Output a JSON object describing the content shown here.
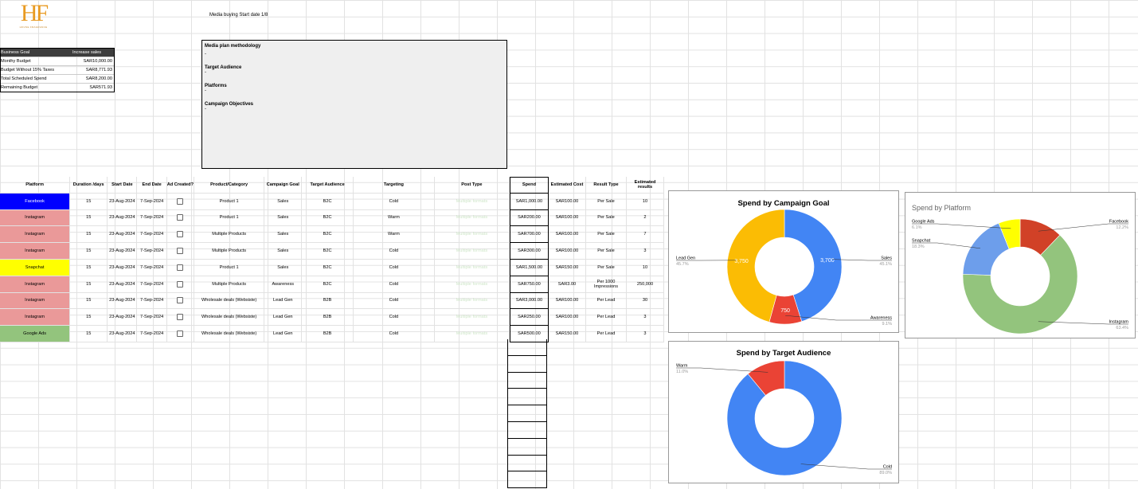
{
  "logo": {
    "mark": "HF",
    "sub": "HOUSE FRAGRANCE"
  },
  "header": {
    "start_date": "Media buying Start date 1/8"
  },
  "summary": [
    {
      "k": "Business Goal",
      "v": "Increase sales"
    },
    {
      "k": "Monthy Budget",
      "v": "SAR10,000.00"
    },
    {
      "k": "Budget Without 15% Taxes",
      "v": "SAR8,771.93"
    },
    {
      "k": "Total Scheduled Spend",
      "v": "SAR8,200.00"
    },
    {
      "k": "Remaining Budget",
      "v": "SAR571.93"
    }
  ],
  "methodology": {
    "title": "Media plan methodology",
    "sections": [
      {
        "h": "Target Audience",
        "d": "-"
      },
      {
        "h": "Platforms",
        "d": "-"
      },
      {
        "h": "Campaign Objectives",
        "d": "-"
      }
    ],
    "first_dash": "-"
  },
  "table": {
    "headers": [
      "Platform",
      "Duration /days",
      "Start Date",
      "End Date",
      "Ad Created?",
      "Product/Category",
      "Campaign Goal",
      "Target Audience",
      "Targeting",
      "Post Type",
      "Spend",
      "Estimated Cost",
      "Result Type",
      "Estimated results"
    ],
    "rows": [
      [
        "Facebook",
        "15",
        "23-Aug-2024",
        "7-Sep-2024",
        "",
        "Product 1",
        "Sales",
        "B2C",
        "Cold",
        "Multiple formats",
        "SAR1,000.00",
        "SAR100.00",
        "Per Sale",
        "10"
      ],
      [
        "Instagram",
        "15",
        "23-Aug-2024",
        "7-Sep-2024",
        "",
        "Product 1",
        "Sales",
        "B2C",
        "Warm",
        "Multiple formats",
        "SAR200.00",
        "SAR100.00",
        "Per Sale",
        "2"
      ],
      [
        "Instagram",
        "15",
        "23-Aug-2024",
        "7-Sep-2024",
        "",
        "Multiple Products",
        "Sales",
        "B2C",
        "Warm",
        "Multiple formats",
        "SAR700.00",
        "SAR100.00",
        "Per Sale",
        "7"
      ],
      [
        "Instagram",
        "15",
        "23-Aug-2024",
        "7-Sep-2024",
        "",
        "Multiple Products",
        "Sales",
        "B2C",
        "Cold",
        "Multiple formats",
        "SAR300.00",
        "SAR100.00",
        "Per Sale",
        "3"
      ],
      [
        "Snapchat",
        "15",
        "23-Aug-2024",
        "7-Sep-2024",
        "",
        "Product 1",
        "Sales",
        "B2C",
        "Cold",
        "Multiple formats",
        "SAR1,500.00",
        "SAR150.00",
        "Per Sale",
        "10"
      ],
      [
        "Instagram",
        "15",
        "23-Aug-2024",
        "7-Sep-2024",
        "",
        "Multiple Products",
        "Awareness",
        "B2C",
        "Cold",
        "Multiple formats",
        "SAR750.00",
        "SAR3.00",
        "Per 1000 Impressions",
        "250,000"
      ],
      [
        "Instagram",
        "15",
        "23-Aug-2024",
        "7-Sep-2024",
        "",
        "Wholesale deals (Websiste)",
        "Lead Gen",
        "B2B",
        "Cold",
        "Multiple formats",
        "SAR3,000.00",
        "SAR100.00",
        "Per Lead",
        "30"
      ],
      [
        "Instagram",
        "15",
        "23-Aug-2024",
        "7-Sep-2024",
        "",
        "Wholesale deals (Websiste)",
        "Lead Gen",
        "B2B",
        "Cold",
        "Multiple formats",
        "SAR250.00",
        "SAR100.00",
        "Per Lead",
        "3"
      ],
      [
        "Google Ads",
        "15",
        "23-Aug-2024",
        "7-Sep-2024",
        "",
        "Wholesale deals (Websiste)",
        "Lead Gen",
        "B2B",
        "Cold",
        "Multiple formats",
        "SAR500.00",
        "SAR150.00",
        "Per Lead",
        "3"
      ]
    ]
  },
  "colors": {
    "Facebook": "#0000ff",
    "Instagram": "#ea9999",
    "Snapchat": "#ffff00",
    "Google Ads": "#93c47d"
  },
  "charts": {
    "goal": {
      "title": "Spend by Campaign Goal",
      "slices": [
        {
          "name": "Sales",
          "value": 3700,
          "label": "3,700",
          "pct": "45.1%",
          "color": "#4285f4"
        },
        {
          "name": "Awareness",
          "value": 750,
          "label": "750",
          "pct": "9.1%",
          "color": "#ea4335"
        },
        {
          "name": "Lead Gen",
          "value": 3750,
          "label": "3,750",
          "pct": "45.7%",
          "color": "#fbbc04"
        }
      ]
    },
    "platform": {
      "title": "Spend by Platform",
      "slices": [
        {
          "name": "Facebook",
          "value": 1000,
          "pct": "12.2%",
          "color": "#d14127"
        },
        {
          "name": "Instagram",
          "value": 5200,
          "pct": "63.4%",
          "color": "#93c47d"
        },
        {
          "name": "Snapchat",
          "value": 1500,
          "pct": "18.3%",
          "color": "#6d9eeb"
        },
        {
          "name": "Google Ads",
          "value": 500,
          "pct": "6.1%",
          "color": "#ffff00"
        }
      ]
    },
    "audience": {
      "title": "Spend by Target Audience",
      "slices": [
        {
          "name": "Cold",
          "value": 7300,
          "pct": "89.0%",
          "color": "#4285f4"
        },
        {
          "name": "Warm",
          "value": 900,
          "pct": "11.0%",
          "color": "#ea4335"
        }
      ]
    }
  }
}
